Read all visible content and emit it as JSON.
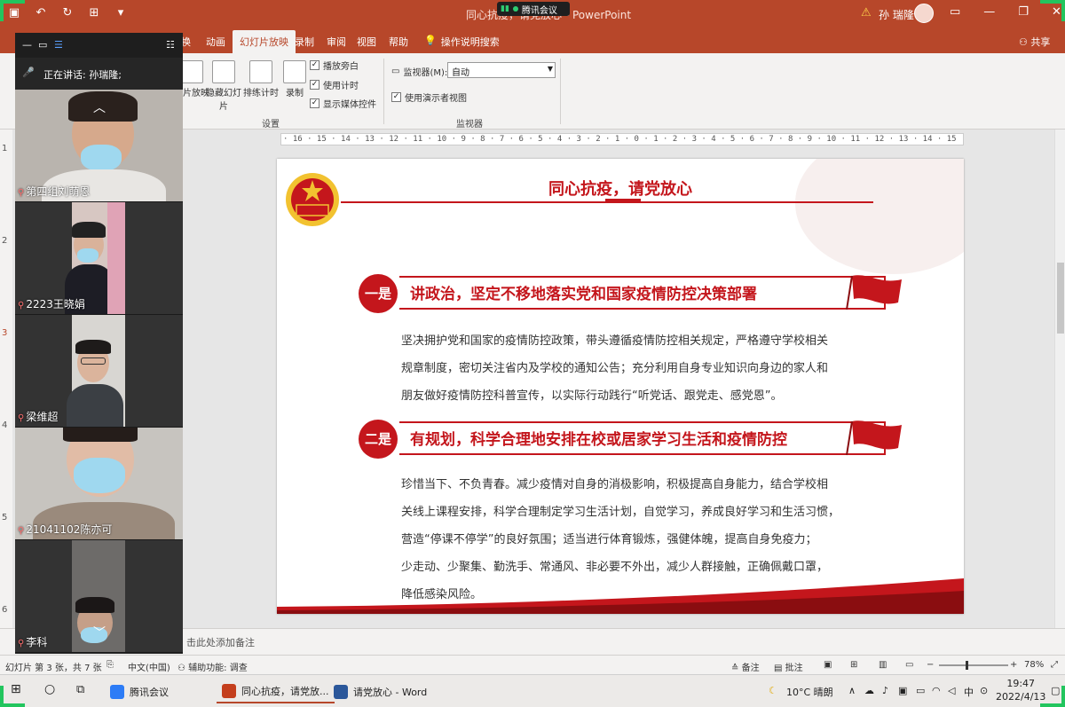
{
  "titlebar": {
    "doc_title": "同心抗疫，请党放心",
    "app_suffix": "PowerPoint",
    "meeting_label": "腾讯会议",
    "user_name": "孙 瑞隆"
  },
  "ribbon_tabs": [
    {
      "label": "换"
    },
    {
      "label": "动画"
    },
    {
      "label": "幻灯片放映",
      "active": true
    },
    {
      "label": "录制"
    },
    {
      "label": "审阅"
    },
    {
      "label": "视图"
    },
    {
      "label": "帮助"
    }
  ],
  "tell_me": "操作说明搜索",
  "share": "共享",
  "ribbon": {
    "btn_custom": "置片放映",
    "btn_hide": "隐藏幻灯片",
    "btn_rehearse": "排练计时",
    "btn_record": "录制",
    "chk_narration": "播放旁白",
    "chk_timing": "使用计时",
    "chk_media": "显示媒体控件",
    "group_setup": "设置",
    "monitor_label": "监视器(M):",
    "monitor_value": "自动",
    "chk_presenter": "使用演示者视图",
    "group_monitor": "监视器"
  },
  "ruler_text": "· 16 · 15 · 14 · 13 · 12 · 11 · 10 · 9 · 8 · 7 · 6 · 5 · 4 · 3 · 2 · 1 · 0 · 1 · 2 · 3 · 4 · 5 · 6 · 7 · 8 · 9 · 10 · 11 · 12 · 13 · 14 · 15 · 16 ·",
  "thumb_numbers": [
    "1",
    "2",
    "3",
    "4",
    "5",
    "6"
  ],
  "slide": {
    "title": "同心抗疫，请党放心",
    "emblem_text": "中国共青团",
    "sections": [
      {
        "badge": "一是",
        "heading": "讲政治，坚定不移地落实党和国家疫情防控决策部署",
        "lines": [
          "坚决拥护党和国家的疫情防控政策，带头遵循疫情防控相关规定，严格遵守学校相关",
          "规章制度，密切关注省内及学校的通知公告；充分利用自身专业知识向身边的家人和",
          "朋友做好疫情防控科普宣传，以实际行动践行“听党话、跟党走、感党恩”。"
        ]
      },
      {
        "badge": "二是",
        "heading": "有规划，科学合理地安排在校或居家学习生活和疫情防控",
        "lines": [
          "珍惜当下、不负青春。减少疫情对自身的消极影响，积极提高自身能力，结合学校相",
          "关线上课程安排，科学合理制定学习生活计划，自觉学习，养成良好学习和生活习惯，",
          "营造“停课不停学”的良好氛围；适当进行体育锻炼，强健体魄，提高自身免疫力；",
          "少走动、少聚集、勤洗手、常通风、非必要不外出，减少人群接触，正确佩戴口罩，",
          "降低感染风险。"
        ]
      }
    ]
  },
  "notes_placeholder": "击此处添加备注",
  "status": {
    "slide_pos": "幻灯片 第 3 张，共 7 张",
    "lang": "中文(中国)",
    "accessibility": "辅助功能: 调查",
    "notes": "备注",
    "comments": "批注",
    "zoom": "78%"
  },
  "taskbar": {
    "meeting_app": "腾讯会议",
    "ppt_app": "同心抗疫，请党放...",
    "word_app": "请党放心 - Word",
    "weather": "10°C 晴朗",
    "ime": "中",
    "time": "19:47",
    "date": "2022/4/13"
  },
  "meeting": {
    "speaking_label": "正在讲话: 孙瑞隆;",
    "participants": [
      {
        "name": "第四组刘萌恩"
      },
      {
        "name": "2223王晓娟"
      },
      {
        "name": "梁维超"
      },
      {
        "name": "21041102陈亦可"
      },
      {
        "name": "李科"
      }
    ]
  },
  "colors": {
    "ppt_accent": "#b7472a",
    "slide_red": "#c4161c",
    "meeting_green": "#22c55e"
  }
}
